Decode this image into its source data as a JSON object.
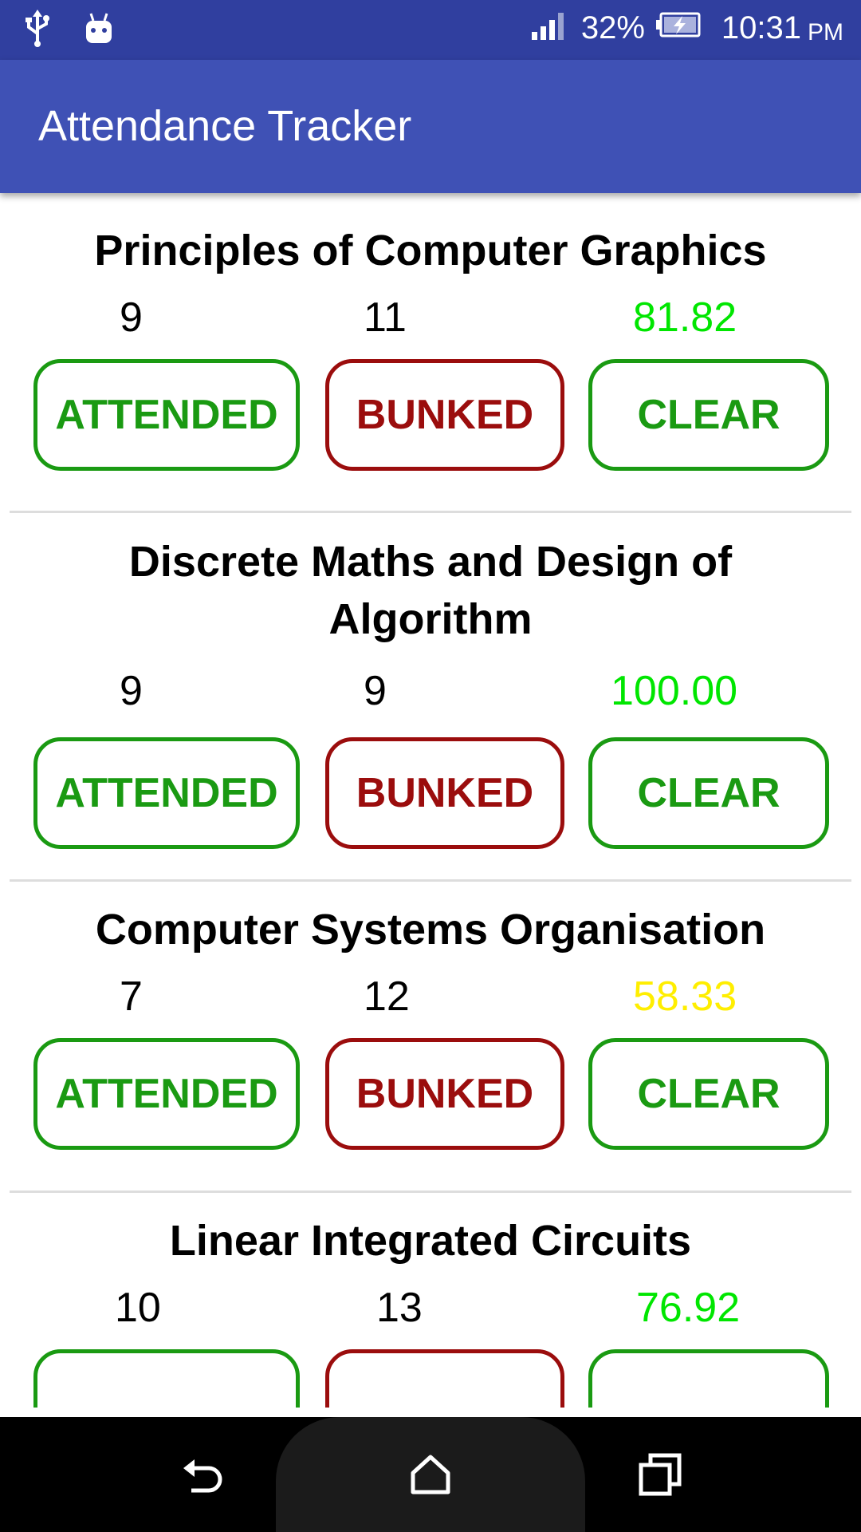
{
  "status_bar": {
    "icons_left": [
      "usb-icon",
      "android-debug-icon"
    ],
    "signal_icon": "signal-icon",
    "battery_percent": "32%",
    "battery_icon": "battery-charging-icon",
    "time": "10:31",
    "ampm": "PM"
  },
  "app_bar": {
    "title": "Attendance Tracker",
    "color": "#3F51B5",
    "status_color": "#303F9F"
  },
  "buttons": {
    "attended": "ATTENDED",
    "bunked": "BUNKED",
    "clear": "CLEAR"
  },
  "subjects": [
    {
      "name": "Principles of Computer Graphics",
      "attended": "9",
      "total": "11",
      "percent": "81.82",
      "percent_color": "#00e600"
    },
    {
      "name": "Discrete Maths and Design of Algorithm",
      "attended": "9",
      "total": "9",
      "percent": "100.00",
      "percent_color": "#00e600"
    },
    {
      "name": "Computer Systems Organisation",
      "attended": "7",
      "total": "12",
      "percent": "58.33",
      "percent_color": "#ffee00"
    },
    {
      "name": "Linear Integrated Circuits",
      "attended": "10",
      "total": "13",
      "percent": "76.92",
      "percent_color": "#00e600"
    }
  ],
  "nav_bar": {
    "back_icon": "back-icon",
    "home_icon": "home-icon",
    "recents_icon": "recents-icon"
  }
}
